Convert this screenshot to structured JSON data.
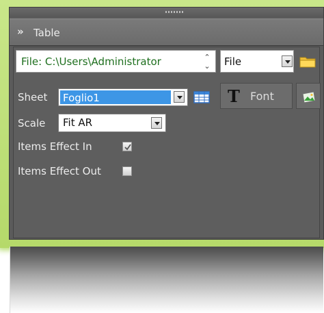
{
  "panel": {
    "title": "Table",
    "collapse_icon": "double-chevron-down-icon"
  },
  "file": {
    "path_value": "File: C:\\Users\\Administrator",
    "source_type": "File",
    "browse_icon": "folder-icon"
  },
  "sheet": {
    "label": "Sheet",
    "value": "Foglio1",
    "grid_icon": "table-grid-icon"
  },
  "font": {
    "label": "Font",
    "icon": "font-T-icon"
  },
  "image_button": {
    "icon": "picture-icon"
  },
  "scale": {
    "label": "Scale",
    "value": "Fit AR"
  },
  "effects": {
    "in_label": "Items Effect In",
    "in_checked": true,
    "out_label": "Items Effect Out",
    "out_checked": false
  },
  "colors": {
    "glow": "#b5d96a",
    "panel_bg": "#5e5e5e",
    "path_text": "#1e6f1e",
    "selection": "#3d96e6"
  }
}
